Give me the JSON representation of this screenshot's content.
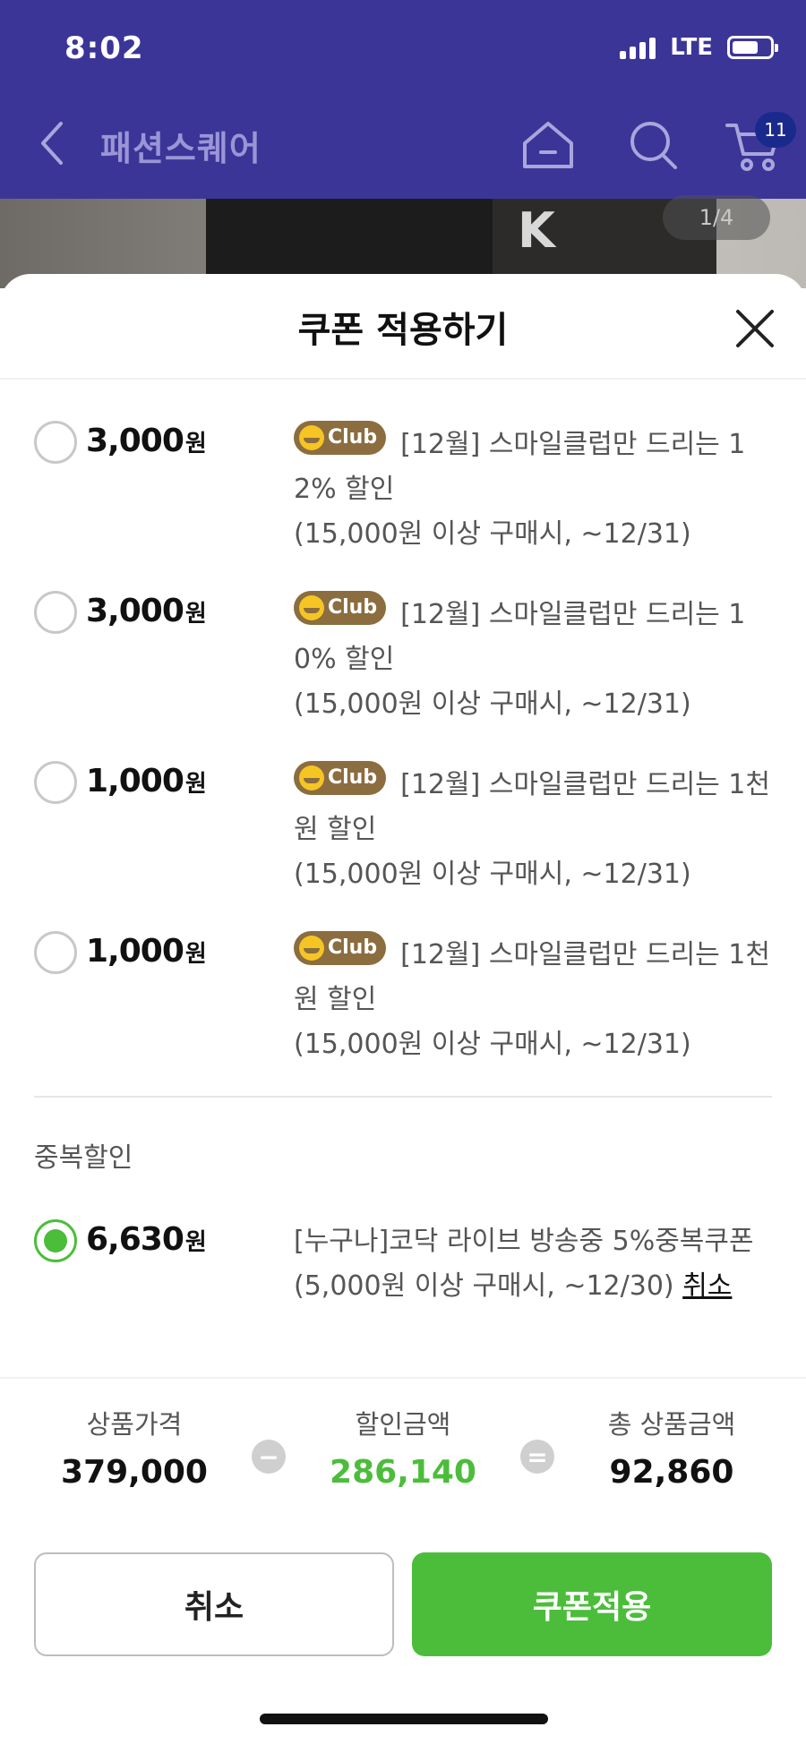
{
  "status_bar": {
    "time": "8:02",
    "network": "LTE"
  },
  "nav": {
    "title": "패션스퀘어",
    "cart_count": "11"
  },
  "product": {
    "page_indicator": "1/4"
  },
  "sheet": {
    "title": "쿠폰 적용하기"
  },
  "coupons": [
    {
      "amount": "3,000",
      "unit": "원",
      "badge": "Club",
      "title": "[12월] 스마일클럽만 드리는 12% 할인",
      "condition": "(15,000원 이상 구매시, ~12/31)",
      "selected": false
    },
    {
      "amount": "3,000",
      "unit": "원",
      "badge": "Club",
      "title": "[12월] 스마일클럽만 드리는 10% 할인",
      "condition": "(15,000원 이상 구매시, ~12/31)",
      "selected": false
    },
    {
      "amount": "1,000",
      "unit": "원",
      "badge": "Club",
      "title": "[12월] 스마일클럽만 드리는 1천원 할인",
      "condition": "(15,000원 이상 구매시, ~12/31)",
      "selected": false
    },
    {
      "amount": "1,000",
      "unit": "원",
      "badge": "Club",
      "title": "[12월] 스마일클럽만 드리는 1천원 할인",
      "condition": "(15,000원 이상 구매시, ~12/31)",
      "selected": false
    }
  ],
  "duplicate_section": {
    "title": "중복할인",
    "coupon": {
      "amount": "6,630",
      "unit": "원",
      "title": "[누구나]코닥 라이브 방송중 5%중복쿠폰",
      "condition": "(5,000원 이상 구매시, ~12/30)",
      "cancel_label": "취소",
      "selected": true
    }
  },
  "summary": {
    "price_label": "상품가격",
    "price_value": "379,000",
    "discount_label": "할인금액",
    "discount_value": "286,140",
    "total_label": "총 상품금액",
    "total_value": "92,860",
    "minus_symbol": "−",
    "equals_symbol": "="
  },
  "buttons": {
    "cancel": "취소",
    "apply": "쿠폰적용"
  },
  "colors": {
    "header_bg": "#3c3598",
    "accent_green": "#4cbd3b",
    "club_badge": "#8b6d3f",
    "badge_bg": "#1a2a8c"
  },
  "icons": [
    "back-icon",
    "home-icon",
    "search-icon",
    "cart-icon",
    "close-icon",
    "smile-club-icon",
    "signal-icon",
    "battery-icon"
  ]
}
